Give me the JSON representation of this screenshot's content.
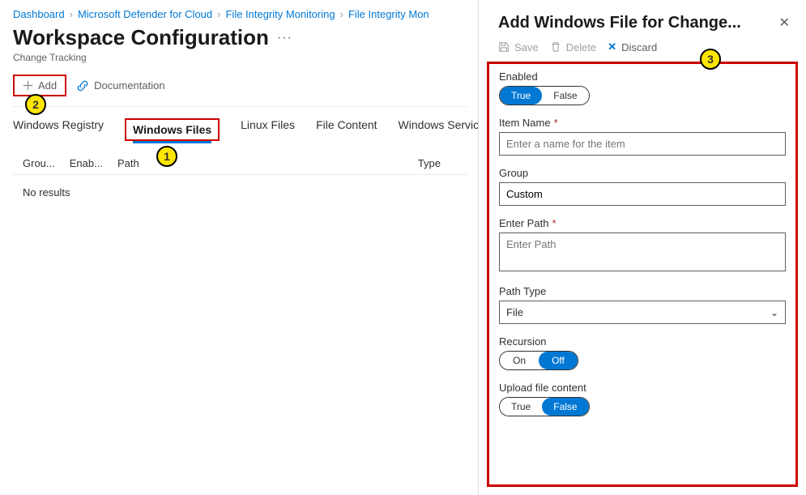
{
  "breadcrumb": [
    "Dashboard",
    "Microsoft Defender for Cloud",
    "File Integrity Monitoring",
    "File Integrity Mon"
  ],
  "page": {
    "title": "Workspace Configuration",
    "subtitle": "Change Tracking"
  },
  "toolbar": {
    "add": "Add",
    "documentation": "Documentation"
  },
  "tabs": [
    "Windows Registry",
    "Windows Files",
    "Linux Files",
    "File Content",
    "Windows Services"
  ],
  "tabs_active_index": 1,
  "columns": {
    "group": "Grou...",
    "enabled": "Enab...",
    "path": "Path",
    "type": "Type"
  },
  "table": {
    "no_results": "No results"
  },
  "panel": {
    "title": "Add Windows File for Change...",
    "actions": {
      "save": "Save",
      "delete": "Delete",
      "discard": "Discard"
    },
    "enabled": {
      "label": "Enabled",
      "opt_true": "True",
      "opt_false": "False",
      "value": "True"
    },
    "item_name": {
      "label": "Item Name",
      "placeholder": "Enter a name for the item",
      "value": ""
    },
    "group": {
      "label": "Group",
      "value": "Custom"
    },
    "enter_path": {
      "label": "Enter Path",
      "placeholder": "Enter Path",
      "value": ""
    },
    "path_type": {
      "label": "Path Type",
      "value": "File"
    },
    "recursion": {
      "label": "Recursion",
      "opt_on": "On",
      "opt_off": "Off",
      "value": "Off"
    },
    "upload": {
      "label": "Upload file content",
      "opt_true": "True",
      "opt_false": "False",
      "value": "False"
    }
  },
  "badges": {
    "1": "1",
    "2": "2",
    "3": "3"
  }
}
